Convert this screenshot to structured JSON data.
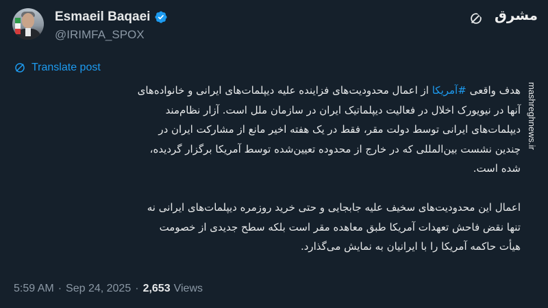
{
  "author": {
    "display_name": "Esmaeil Baqaei",
    "handle": "@IRIMFA_SPOX",
    "verified": true
  },
  "watermark": {
    "logo_text": "مشرق",
    "site": "mashreghnews.ir"
  },
  "translate_label": "Translate post",
  "body": {
    "para1_lead": "هدف واقعی",
    "hashtag": "#آمریکا",
    "para1_rest": " از اعمال محدودیت‌های فزاینده علیه دیپلمات‌های ایرانی و خانواده‌های آنها در نیویورک اخلال در فعالیت دیپلماتیک ایران در سازمان ملل است. آزار نظام‌مند دیپلمات‌های ایرانی توسط دولت مقر، فقط در یک هفته اخیر مانع از مشارکت ایران در چندین نشست بین‌المللی که در خارج از محدوده تعیین‌شده توسط آمریکا برگزار گردیده، شده است.",
    "para2": "اعمال این محدودیت‌های سخیف علیه جابجایی و حتی خرید روزمره دیپلمات‌های ایرانی نه تنها نقض فاحش تعهدات آمریکا طبق معاهده مقر است بلکه سطح جدیدی از خصومت هیأت حاکمه آمریکا را با ایرانیان به نمایش می‌گذارد."
  },
  "meta": {
    "time": "5:59 AM",
    "separator1": "·",
    "date": "Sep 24, 2025",
    "separator2": "·",
    "views_count": "2,653",
    "views_label": "Views"
  },
  "colors": {
    "background": "#15202b",
    "text": "#e7e9ea",
    "secondary": "#8b98a5",
    "accent": "#1d9bf0"
  },
  "icons": {
    "verified": "verified-badge-icon",
    "grok": "grok-icon",
    "translate": "translate-globe-icon"
  }
}
